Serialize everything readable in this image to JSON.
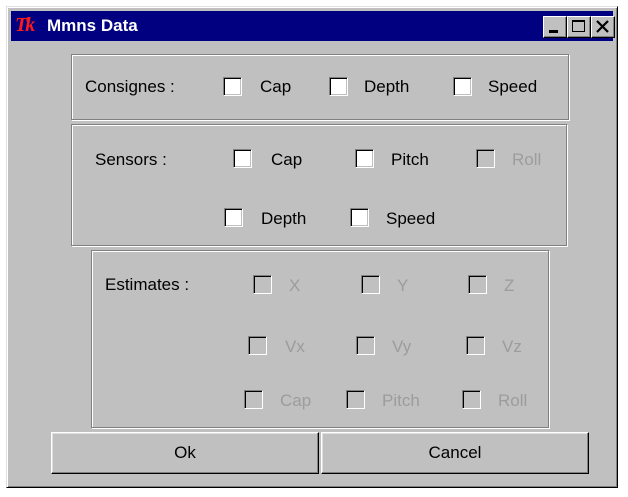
{
  "window": {
    "title": "Mmns Data",
    "logo": "tk-logo-icon"
  },
  "consignes": {
    "label": "Consignes :",
    "options": [
      {
        "label": "Cap",
        "checked": false,
        "enabled": true
      },
      {
        "label": "Depth",
        "checked": false,
        "enabled": true
      },
      {
        "label": "Speed",
        "checked": false,
        "enabled": true
      }
    ]
  },
  "sensors": {
    "label": "Sensors :",
    "options": [
      {
        "label": "Cap",
        "checked": false,
        "enabled": true
      },
      {
        "label": "Pitch",
        "checked": false,
        "enabled": true
      },
      {
        "label": "Roll",
        "checked": false,
        "enabled": false
      },
      {
        "label": "Depth",
        "checked": false,
        "enabled": true
      },
      {
        "label": "Speed",
        "checked": false,
        "enabled": true
      }
    ]
  },
  "estimates": {
    "label": "Estimates :",
    "options": [
      {
        "label": "X",
        "checked": false,
        "enabled": false
      },
      {
        "label": "Y",
        "checked": false,
        "enabled": false
      },
      {
        "label": "Z",
        "checked": false,
        "enabled": false
      },
      {
        "label": "Vx",
        "checked": false,
        "enabled": false
      },
      {
        "label": "Vy",
        "checked": false,
        "enabled": false
      },
      {
        "label": "Vz",
        "checked": false,
        "enabled": false
      },
      {
        "label": "Cap",
        "checked": false,
        "enabled": false
      },
      {
        "label": "Pitch",
        "checked": false,
        "enabled": false
      },
      {
        "label": "Roll",
        "checked": false,
        "enabled": false
      }
    ]
  },
  "buttons": {
    "ok": "Ok",
    "cancel": "Cancel"
  }
}
